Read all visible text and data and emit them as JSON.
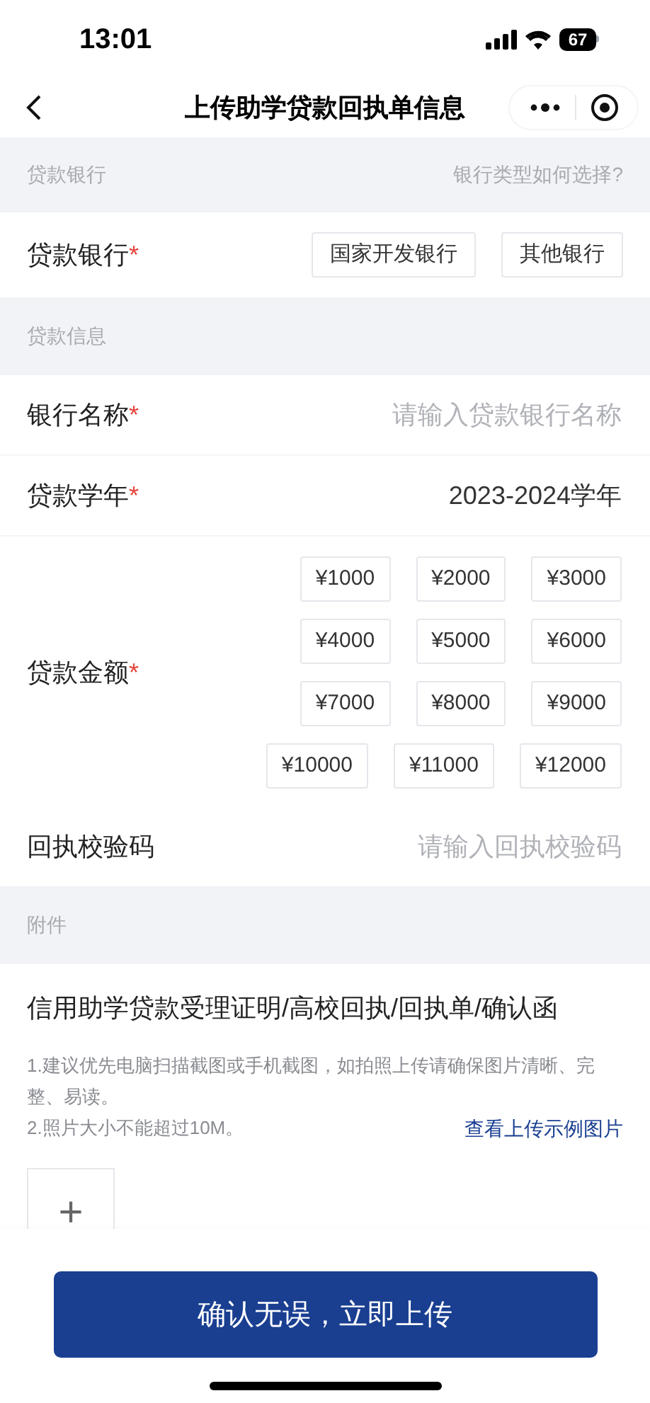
{
  "status_bar": {
    "time": "13:01",
    "battery": "67"
  },
  "nav": {
    "title": "上传助学贷款回执单信息"
  },
  "bank_section": {
    "header": "贷款银行",
    "help_link": "银行类型如何选择?",
    "label": "贷款银行",
    "required_mark": "*",
    "options": [
      {
        "label": "国家开发银行",
        "selected": false
      },
      {
        "label": "其他银行",
        "selected": false
      }
    ]
  },
  "loan_section": {
    "header": "贷款信息",
    "fields": [
      {
        "label": "银行名称",
        "required_mark": "*",
        "placeholder": "请输入贷款银行名称"
      },
      {
        "label": "贷款学年",
        "required_mark": "*",
        "value": "2023-2024学年"
      }
    ],
    "amount": {
      "label": "贷款金额",
      "required_mark": "*",
      "options": [
        {
          "label": "¥1000",
          "selected": false
        },
        {
          "label": "¥2000",
          "selected": false
        },
        {
          "label": "¥3000",
          "selected": false
        },
        {
          "label": "¥4000",
          "selected": false
        },
        {
          "label": "¥5000",
          "selected": false
        },
        {
          "label": "¥6000",
          "selected": false
        },
        {
          "label": "¥7000",
          "selected": false
        },
        {
          "label": "¥8000",
          "selected": false
        },
        {
          "label": "¥9000",
          "selected": false
        },
        {
          "label": "¥10000",
          "selected": false
        },
        {
          "label": "¥11000",
          "selected": false
        },
        {
          "label": "¥12000",
          "selected": false
        }
      ]
    },
    "code_field": {
      "label": "回执校验码",
      "placeholder": "请输入回执校验码"
    }
  },
  "attachment_section": {
    "header": "附件",
    "title": "信用助学贷款受理证明/高校回执/回执单/确认函",
    "notes": [
      "1.建议优先电脑扫描截图或手机截图，如拍照上传请确保图片清晰、完整、易读。",
      "2.照片大小不能超过10M。"
    ],
    "example_link": "查看上传示例图片",
    "upload_symbol": "+"
  },
  "submit_button": "确认无误，立即上传"
}
